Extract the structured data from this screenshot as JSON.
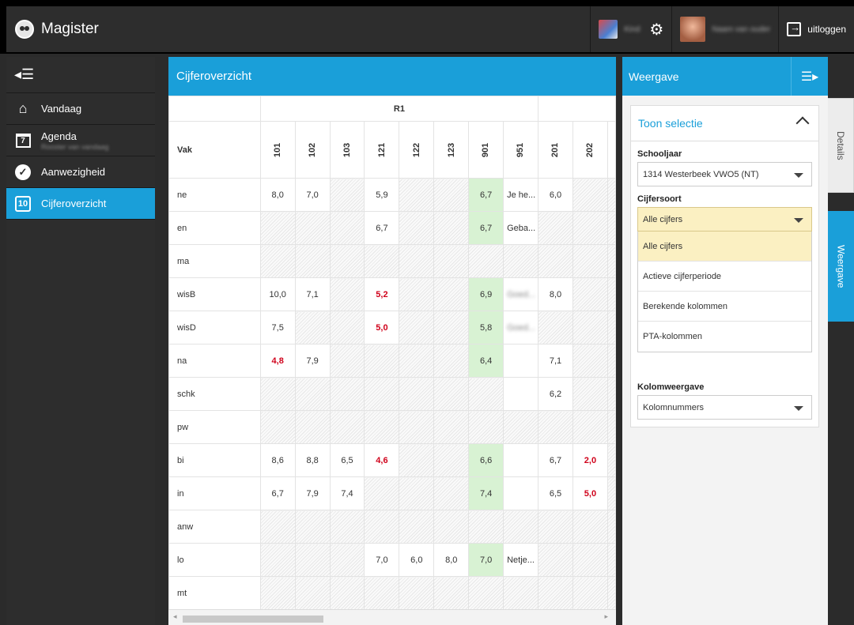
{
  "app": {
    "name": "Magister",
    "logout_label": "uitloggen",
    "user_a": "Kind",
    "user_b": "Naam van ouder"
  },
  "sidebar": {
    "items": [
      {
        "label": "Vandaag",
        "icon": "home-icon"
      },
      {
        "label": "Agenda",
        "sub": "Rooster van vandaag",
        "icon": "calendar-icon",
        "icon_text": "7"
      },
      {
        "label": "Aanwezigheid",
        "icon": "check-circle-icon"
      },
      {
        "label": "Cijferoverzicht",
        "icon": "grades-icon",
        "icon_text": "10",
        "active": true
      }
    ]
  },
  "main": {
    "title": "Cijferoverzicht",
    "table": {
      "group": "R1",
      "vak_header": "Vak",
      "columns": [
        "101",
        "102",
        "103",
        "121",
        "122",
        "123",
        "901",
        "951",
        "201",
        "202"
      ],
      "rows": [
        {
          "vak": "ne",
          "cells": [
            "8,0",
            "7,0",
            "",
            "5,9",
            "",
            "",
            "6,7",
            "Je he...",
            "6,0",
            ""
          ]
        },
        {
          "vak": "en",
          "cells": [
            "",
            "",
            "",
            "6,7",
            "",
            "",
            "6,7",
            "Geba...",
            "",
            ""
          ]
        },
        {
          "vak": "ma",
          "cells": [
            "",
            "",
            "",
            "",
            "",
            "",
            "",
            "",
            "",
            ""
          ]
        },
        {
          "vak": "wisB",
          "cells": [
            "10,0",
            "7,1",
            "",
            "5,2",
            "",
            "",
            "6,9",
            "Goed...",
            "8,0",
            ""
          ]
        },
        {
          "vak": "wisD",
          "cells": [
            "7,5",
            "",
            "",
            "5,0",
            "",
            "",
            "5,8",
            "Goed...",
            "",
            ""
          ]
        },
        {
          "vak": "na",
          "cells": [
            "4,8",
            "7,9",
            "",
            "",
            "",
            "",
            "6,4",
            "",
            "7,1",
            ""
          ]
        },
        {
          "vak": "schk",
          "cells": [
            "",
            "",
            "",
            "",
            "",
            "",
            "",
            "",
            "6,2",
            ""
          ]
        },
        {
          "vak": "pw",
          "cells": [
            "",
            "",
            "",
            "",
            "",
            "",
            "",
            "",
            "",
            ""
          ]
        },
        {
          "vak": "bi",
          "cells": [
            "8,6",
            "8,8",
            "6,5",
            "4,6",
            "",
            "",
            "6,6",
            "",
            "6,7",
            "2,0"
          ]
        },
        {
          "vak": "in",
          "cells": [
            "6,7",
            "7,9",
            "7,4",
            "",
            "",
            "",
            "7,4",
            "",
            "6,5",
            "5,0"
          ]
        },
        {
          "vak": "anw",
          "cells": [
            "",
            "",
            "",
            "",
            "",
            "",
            "",
            "",
            "",
            ""
          ]
        },
        {
          "vak": "lo",
          "cells": [
            "",
            "",
            "",
            "7,0",
            "6,0",
            "8,0",
            "7,0",
            "Netje...",
            "",
            ""
          ]
        },
        {
          "vak": "mt",
          "cells": [
            "",
            "",
            "",
            "",
            "",
            "",
            "",
            "",
            "",
            ""
          ]
        }
      ]
    }
  },
  "weergave": {
    "title": "Weergave",
    "section_title": "Toon selectie",
    "schooljaar_label": "Schooljaar",
    "schooljaar_value": "1314 Westerbeek VWO5 (NT)",
    "cijfersoort_label": "Cijfersoort",
    "cijfersoort_value": "Alle cijfers",
    "cijfersoort_options": [
      "Alle cijfers",
      "Actieve cijferperiode",
      "Berekende kolommen",
      "PTA-kolommen"
    ],
    "kolomweergave_label": "Kolomweergave",
    "kolomweergave_value": "Kolomnummers"
  },
  "tabs": {
    "details": "Details",
    "weergave": "Weergave"
  },
  "colors": {
    "accent": "#1a9fd9",
    "fail": "#d0021b",
    "highlight_green": "#d8f2d3"
  }
}
